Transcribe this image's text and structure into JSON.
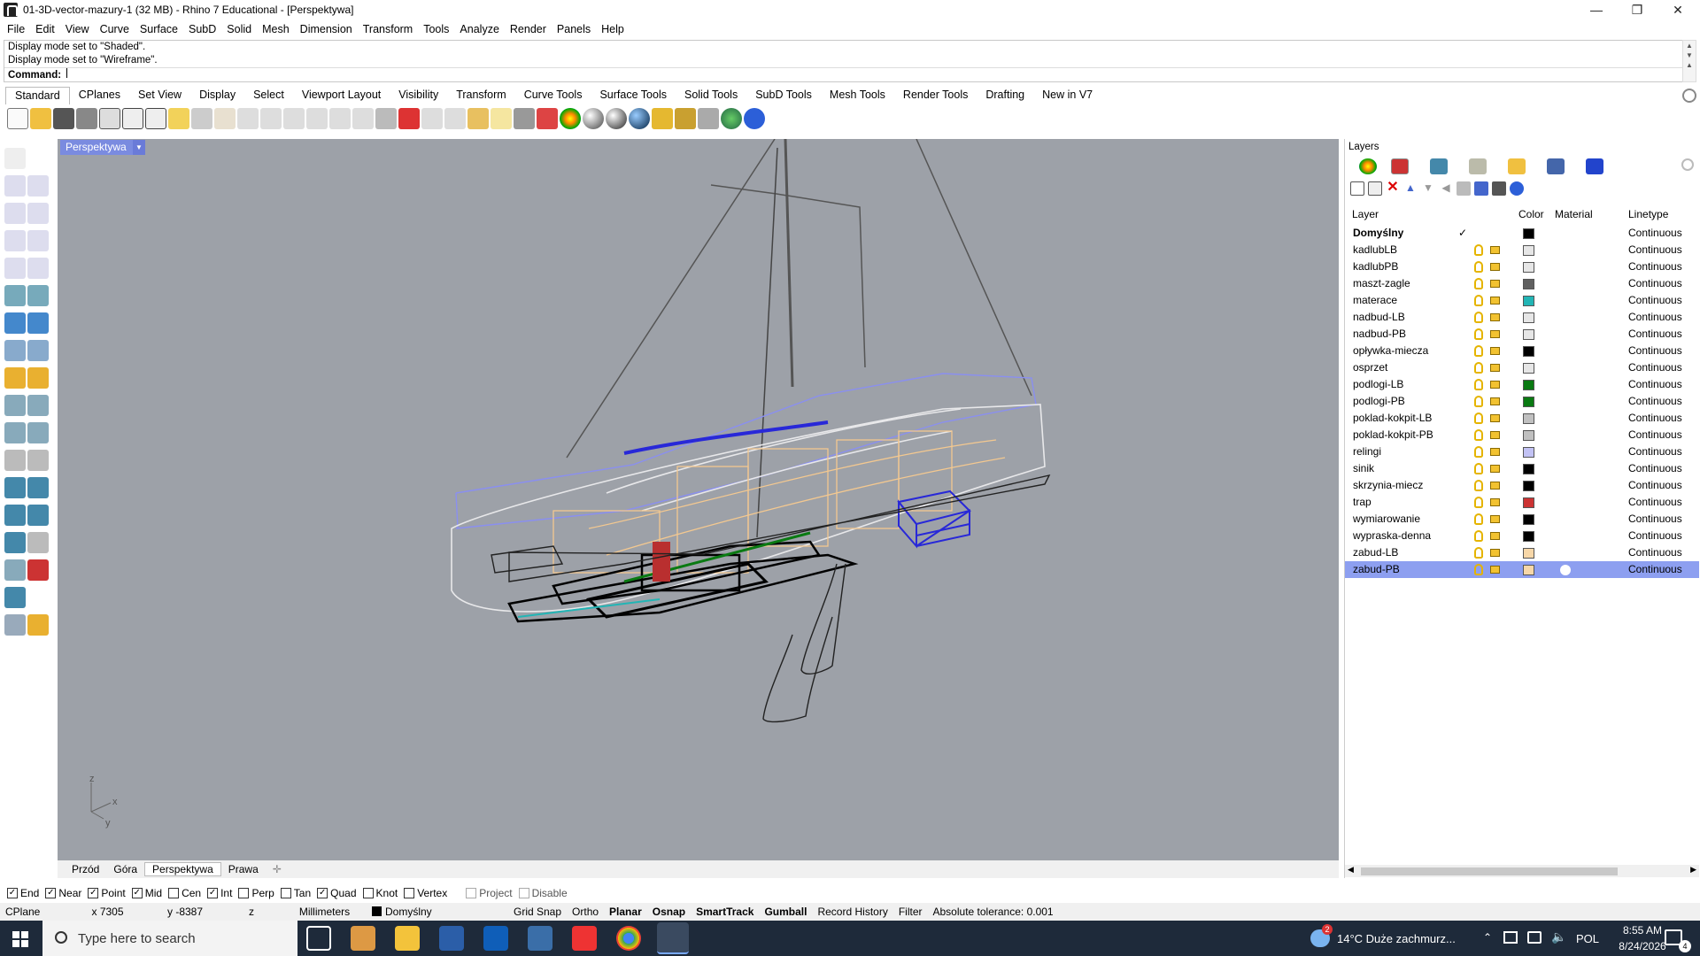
{
  "window": {
    "title": "01-3D-vector-mazury-1 (32 MB) - Rhino 7 Educational - [Perspektywa]",
    "controls": [
      "—",
      "❐",
      "✕"
    ]
  },
  "menu": [
    "File",
    "Edit",
    "View",
    "Curve",
    "Surface",
    "SubD",
    "Solid",
    "Mesh",
    "Dimension",
    "Transform",
    "Tools",
    "Analyze",
    "Render",
    "Panels",
    "Help"
  ],
  "command": {
    "history": [
      "Display mode set to \"Shaded\".",
      "Display mode set to \"Wireframe\"."
    ],
    "prompt": "Command:",
    "value": ""
  },
  "toolbar_tabs": [
    "Standard",
    "CPlanes",
    "Set View",
    "Display",
    "Select",
    "Viewport Layout",
    "Visibility",
    "Transform",
    "Curve Tools",
    "Surface Tools",
    "Solid Tools",
    "SubD Tools",
    "Mesh Tools",
    "Render Tools",
    "Drafting",
    "New in V7"
  ],
  "toolbar_active": "Standard",
  "viewport": {
    "label": "Perspektywa",
    "axes": {
      "z": "z",
      "x": "x",
      "y": "y"
    }
  },
  "view_tabs": [
    "Przód",
    "Góra",
    "Perspektywa",
    "Prawa"
  ],
  "layers_panel": {
    "title": "Layers",
    "columns": {
      "layer": "Layer",
      "color": "Color",
      "material": "Material",
      "linetype": "Linetype"
    },
    "rows": [
      {
        "name": "Domyślny",
        "color": "#000000",
        "linetype": "Continuous",
        "current": true
      },
      {
        "name": "kadlubLB",
        "color": "#e6e6e6",
        "linetype": "Continuous"
      },
      {
        "name": "kadlubPB",
        "color": "#e6e6e6",
        "linetype": "Continuous"
      },
      {
        "name": "maszt-zagle",
        "color": "#606060",
        "linetype": "Continuous"
      },
      {
        "name": "materace",
        "color": "#22b5b5",
        "linetype": "Continuous"
      },
      {
        "name": "nadbud-LB",
        "color": "#e6e6e6",
        "linetype": "Continuous"
      },
      {
        "name": "nadbud-PB",
        "color": "#e6e6e6",
        "linetype": "Continuous"
      },
      {
        "name": "opływka-miecza",
        "color": "#000000",
        "linetype": "Continuous"
      },
      {
        "name": "osprzet",
        "color": "#e6e6e6",
        "linetype": "Continuous"
      },
      {
        "name": "podlogi-LB",
        "color": "#0a7a12",
        "linetype": "Continuous"
      },
      {
        "name": "podlogi-PB",
        "color": "#0a7a12",
        "linetype": "Continuous"
      },
      {
        "name": "poklad-kokpit-LB",
        "color": "#c0c0c0",
        "linetype": "Continuous"
      },
      {
        "name": "poklad-kokpit-PB",
        "color": "#c0c0c0",
        "linetype": "Continuous"
      },
      {
        "name": "relingi",
        "color": "#c2c2f4",
        "linetype": "Continuous"
      },
      {
        "name": "sinik",
        "color": "#000000",
        "linetype": "Continuous"
      },
      {
        "name": "skrzynia-miecz",
        "color": "#000000",
        "linetype": "Continuous"
      },
      {
        "name": "trap",
        "color": "#cc3333",
        "linetype": "Continuous"
      },
      {
        "name": "wymiarowanie",
        "color": "#000000",
        "linetype": "Continuous"
      },
      {
        "name": "wypraska-denna",
        "color": "#000000",
        "linetype": "Continuous"
      },
      {
        "name": "zabud-LB",
        "color": "#f7d7a8",
        "linetype": "Continuous"
      },
      {
        "name": "zabud-PB",
        "color": "#f7d7a8",
        "linetype": "Continuous",
        "selected": true
      }
    ]
  },
  "osnap": [
    {
      "label": "End",
      "checked": true
    },
    {
      "label": "Near",
      "checked": true
    },
    {
      "label": "Point",
      "checked": true
    },
    {
      "label": "Mid",
      "checked": true
    },
    {
      "label": "Cen",
      "checked": false
    },
    {
      "label": "Int",
      "checked": true
    },
    {
      "label": "Perp",
      "checked": false
    },
    {
      "label": "Tan",
      "checked": false
    },
    {
      "label": "Quad",
      "checked": true
    },
    {
      "label": "Knot",
      "checked": false
    },
    {
      "label": "Vertex",
      "checked": false
    },
    {
      "label": "Project",
      "checked": false,
      "disabled": true
    },
    {
      "label": "Disable",
      "checked": false,
      "disabled": true
    }
  ],
  "statusbar": {
    "cplane": "CPlane",
    "x": "x 7305",
    "y": "y -8387",
    "z": "z",
    "units": "Millimeters",
    "layer": "Domyślny",
    "toggles": [
      "Grid Snap",
      "Ortho",
      "Planar",
      "Osnap",
      "SmartTrack",
      "Gumball",
      "Record History",
      "Filter"
    ],
    "tolerance": "Absolute tolerance: 0.001"
  },
  "taskbar": {
    "search_placeholder": "Type here to search",
    "weather_badge": "2",
    "weather": "14°C  Duże zachmurz...",
    "language": "POL",
    "time": "8:55 AM",
    "date": "8/24/2026",
    "notif_count": "4"
  }
}
